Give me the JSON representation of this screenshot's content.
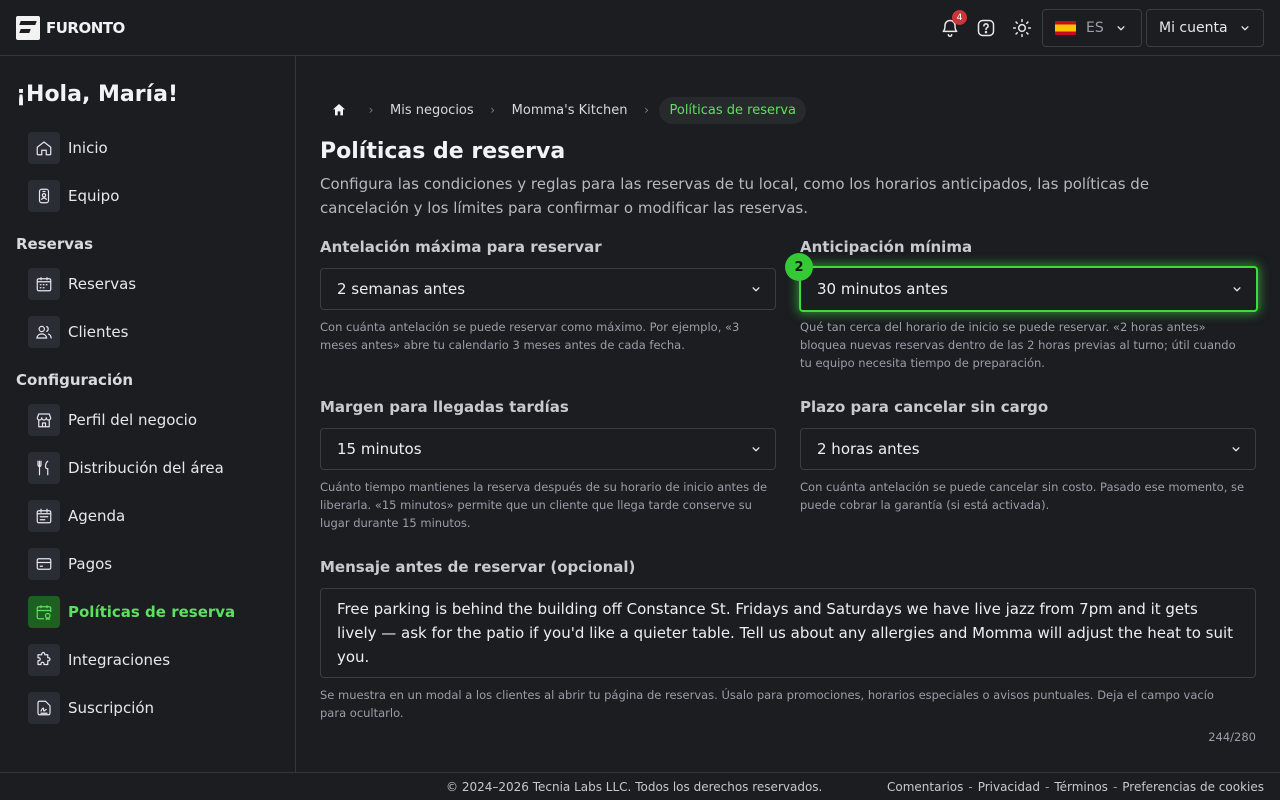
{
  "header": {
    "logo_text": "FURONTO",
    "notifications_count": "4",
    "language_code": "ES",
    "account_label": "Mi cuenta"
  },
  "sidebar": {
    "greeting": "¡Hola, María!",
    "top_items": [
      {
        "label": "Inicio",
        "icon": "home-icon"
      },
      {
        "label": "Equipo",
        "icon": "team-badge-icon"
      }
    ],
    "section_reservas": "Reservas",
    "reservas_items": [
      {
        "label": "Reservas",
        "icon": "calendar-icon"
      },
      {
        "label": "Clientes",
        "icon": "users-icon"
      }
    ],
    "section_config": "Configuración",
    "config_items": [
      {
        "label": "Perfil del negocio",
        "icon": "store-icon"
      },
      {
        "label": "Distribución del área",
        "icon": "utensils-icon"
      },
      {
        "label": "Agenda",
        "icon": "calendar-list-icon"
      },
      {
        "label": "Pagos",
        "icon": "credit-card-icon"
      },
      {
        "label": "Políticas de reserva",
        "icon": "policy-calendar-icon",
        "active": true
      },
      {
        "label": "Integraciones",
        "icon": "puzzle-icon"
      },
      {
        "label": "Suscripción",
        "icon": "signature-icon"
      }
    ],
    "accent_color": "#5de05f"
  },
  "breadcrumb": {
    "items": [
      "Mis negocios",
      "Momma's Kitchen"
    ],
    "current": "Políticas de reserva"
  },
  "page": {
    "title": "Políticas de reserva",
    "description": "Configura las condiciones y reglas para las reservas de tu local, como los horarios anticipados, las políticas de cancelación y los límites para confirmar o modificar las reservas."
  },
  "fields": {
    "max_advance": {
      "label": "Antelación máxima para reservar",
      "value": "2 semanas antes",
      "help": "Con cuánta antelación se puede reservar como máximo. Por ejemplo, «3 meses antes» abre tu calendario 3 meses antes de cada fecha."
    },
    "min_advance": {
      "label": "Anticipación mínima",
      "value": "30 minutos antes",
      "help": "Qué tan cerca del horario de inicio se puede reservar. «2 horas antes» bloquea nuevas reservas dentro de las 2 horas previas al turno; útil cuando tu equipo necesita tiempo de preparación.",
      "marker": "2"
    },
    "late_margin": {
      "label": "Margen para llegadas tardías",
      "value": "15 minutos",
      "help": "Cuánto tiempo mantienes la reserva después de su horario de inicio antes de liberarla. «15 minutos» permite que un cliente que llega tarde conserve su lugar durante 15 minutos."
    },
    "cancel_window": {
      "label": "Plazo para cancelar sin cargo",
      "value": "2 horas antes",
      "help": "Con cuánta antelación se puede cancelar sin costo. Pasado ese momento, se puede cobrar la garantía (si está activada)."
    },
    "message": {
      "label": "Mensaje antes de reservar (opcional)",
      "value": "Free parking is behind the building off Constance St. Fridays and Saturdays we have live jazz from 7pm and it gets lively — ask for the patio if you'd like a quieter table. Tell us about any allergies and Momma will adjust the heat to suit you.",
      "help": "Se muestra en un modal a los clientes al abrir tu página de reservas. Úsalo para promociones, horarios especiales o avisos puntuales. Deja el campo vacío para ocultarlo.",
      "counter": "244/280"
    }
  },
  "footer": {
    "copyright": "© 2024–2026 Tecnia Labs LLC. Todos los derechos reservados.",
    "links": [
      "Comentarios",
      "Privacidad",
      "Términos",
      "Preferencias de cookies"
    ],
    "separator": "-"
  }
}
